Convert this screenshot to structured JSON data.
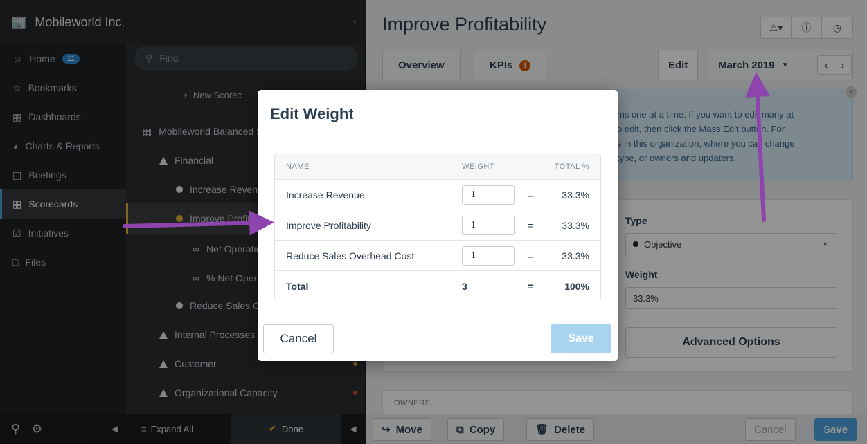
{
  "sidebar": {
    "org_name": "Mobileworld Inc.",
    "items": [
      {
        "label": "Home",
        "badge": "11",
        "icon": "user-icon"
      },
      {
        "label": "Bookmarks",
        "icon": "star-icon"
      },
      {
        "label": "Dashboards",
        "icon": "dashboard-icon"
      },
      {
        "label": "Charts & Reports",
        "icon": "pie-chart-icon"
      },
      {
        "label": "Briefings",
        "icon": "book-icon"
      },
      {
        "label": "Scorecards",
        "icon": "scorecard-icon",
        "active": true
      },
      {
        "label": "Initiatives",
        "icon": "check-square-icon"
      },
      {
        "label": "Files",
        "icon": "file-icon"
      }
    ]
  },
  "tree": {
    "search_placeholder": "Find",
    "new_scorecard": "New Scorec",
    "items": [
      {
        "label": "Mobileworld Balanced Scorecard"
      },
      {
        "label": "Financial"
      },
      {
        "label": "Increase Revenue"
      },
      {
        "label": "Improve Profitability"
      },
      {
        "label": "Net Operating"
      },
      {
        "label": "% Net Operating"
      },
      {
        "label": "Reduce Sales Overhead Cost"
      },
      {
        "label": "Internal Processes"
      },
      {
        "label": "Customer"
      },
      {
        "label": "Organizational Capacity"
      }
    ],
    "expand_all": "Expand All",
    "done": "Done"
  },
  "main": {
    "title": "Improve Profitability",
    "tabs": [
      "Overview",
      "KPIs"
    ],
    "kpi_alert": "!",
    "edit_tab": "Edit",
    "period": "March 2019",
    "info_lines": [
      "ms one at a time. If you want to edit many at",
      "o edit, then click the Mass Edit button. For",
      "s in this organization, where you can change",
      "type, or owners and updaters."
    ],
    "type_label": "Type",
    "type_value": "Objective",
    "weight_label": "Weight",
    "weight_value": "33.3%",
    "advanced": "Advanced Options",
    "owners_label": "OWNERS",
    "bottom": {
      "move": "Move",
      "copy": "Copy",
      "delete": "Delete",
      "cancel": "Cancel",
      "save": "Save"
    }
  },
  "modal": {
    "title": "Edit Weight",
    "columns": {
      "name": "NAME",
      "weight": "WEIGHT",
      "total": "TOTAL %"
    },
    "rows": [
      {
        "name": "Increase Revenue",
        "weight": "1",
        "eq": "=",
        "total": "33.3%"
      },
      {
        "name": "Improve Profitability",
        "weight": "1",
        "eq": "=",
        "total": "33.3%"
      },
      {
        "name": "Reduce Sales Overhead Cost",
        "weight": "1",
        "eq": "=",
        "total": "33.3%"
      }
    ],
    "total_row": {
      "name": "Total",
      "weight": "3",
      "eq": "=",
      "total": "100%"
    },
    "cancel": "Cancel",
    "save": "Save"
  },
  "colors": {
    "accent": "#4aa3df",
    "arrow": "#8e44ad",
    "objective_yellow": "#e2b33a",
    "alert": "#d35400"
  }
}
